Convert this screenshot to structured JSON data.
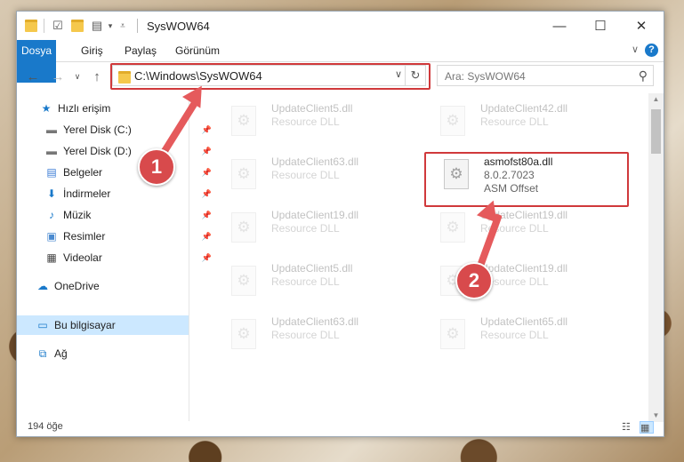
{
  "window": {
    "title": "SysWOW64",
    "controls": {
      "minimize": "—",
      "maximize": "☐",
      "close": "✕"
    }
  },
  "ribbon": {
    "tabs": [
      "Dosya",
      "Giriş",
      "Paylaş",
      "Görünüm"
    ],
    "help": "?"
  },
  "address": {
    "path": "C:\\Windows\\SysWOW64",
    "refresh": "↻",
    "dropdown": "∨"
  },
  "search": {
    "placeholder": "Ara: SysWOW64"
  },
  "nav": {
    "quick_access": "Hızlı erişim",
    "items": [
      {
        "label": "Yerel Disk (C:)",
        "icon": "drive-icon"
      },
      {
        "label": "Yerel Disk (D:)",
        "icon": "drive-icon"
      },
      {
        "label": "Belgeler",
        "icon": "documents-icon"
      },
      {
        "label": "İndirmeler",
        "icon": "downloads-icon"
      },
      {
        "label": "Müzik",
        "icon": "music-icon"
      },
      {
        "label": "Resimler",
        "icon": "pictures-icon"
      },
      {
        "label": "Videolar",
        "icon": "videos-icon"
      }
    ],
    "onedrive": "OneDrive",
    "this_pc": "Bu bilgisayar",
    "network": "Ağ"
  },
  "files": [
    {
      "name": "UpdateClient5.dll",
      "line2": "Resource DLL",
      "line3": "",
      "highlight": false
    },
    {
      "name": "UpdateClient42.dll",
      "line2": "Resource DLL",
      "line3": "",
      "highlight": false
    },
    {
      "name": "UpdateClient63.dll",
      "line2": "Resource DLL",
      "line3": "",
      "highlight": false
    },
    {
      "name": "asmofst80a.dll",
      "line2": "8.0.2.7023",
      "line3": "ASM Offset",
      "highlight": true
    },
    {
      "name": "UpdateClient19.dll",
      "line2": "Resource DLL",
      "line3": "",
      "highlight": false
    },
    {
      "name": "UpdateClient19.dll",
      "line2": "Resource DLL",
      "line3": "",
      "highlight": false
    },
    {
      "name": "UpdateClient5.dll",
      "line2": "Resource DLL",
      "line3": "",
      "highlight": false
    },
    {
      "name": "UpdateClient19.dll",
      "line2": "Resource DLL",
      "line3": "",
      "highlight": false
    },
    {
      "name": "UpdateClient63.dll",
      "line2": "Resource DLL",
      "line3": "",
      "highlight": false
    },
    {
      "name": "UpdateClient65.dll",
      "line2": "Resource DLL",
      "line3": "",
      "highlight": false
    }
  ],
  "status": {
    "count": "194 öğe"
  },
  "annotations": {
    "step1": "1",
    "step2": "2"
  },
  "colors": {
    "accent": "#1979ca",
    "annotation": "#d0393b",
    "selected": "#cce8ff"
  }
}
